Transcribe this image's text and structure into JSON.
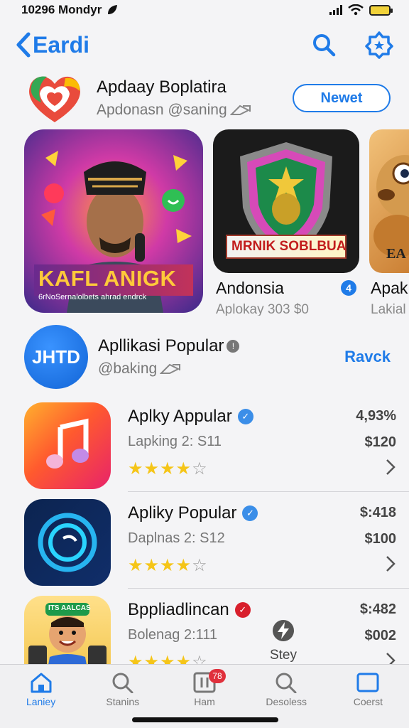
{
  "status": {
    "time": "10296 Mondyr"
  },
  "nav": {
    "back_title": "Eardi"
  },
  "featured": {
    "title": "Apdaay Boplatira",
    "subtitle": "Apdonasn @saning",
    "button_label": "Newet"
  },
  "carousel": {
    "big": {
      "title": "KAFL ANIGK",
      "subtitle": "6rNoSernalolbets ahrad endrck"
    },
    "mid": {
      "art_title": "MRNIK SOBLBUA",
      "caption": "Andonsia",
      "badge": "4",
      "sub": "Aplokay 303  $0"
    },
    "small": {
      "art_title": "EA",
      "caption": "Apak",
      "sub": "Lakial"
    }
  },
  "section": {
    "logo_text": "JHTD",
    "title": "Apllikasi Popular",
    "subtitle": "@baking",
    "link_label": "Ravck"
  },
  "apps": [
    {
      "title": "Aplky Appular",
      "sub": "Lapking 2: S11",
      "rating": "4,93%",
      "price": "$120",
      "stars": 4
    },
    {
      "title": "Apliky Popular",
      "sub": "Daplnas 2: S12",
      "rating": "$:418",
      "price": "$100",
      "stars": 4
    },
    {
      "title": "Bppliadlincan",
      "sub": "Bolenag 2:111",
      "rating": "$:482",
      "price": "$002",
      "stars": 4
    }
  ],
  "third_icon_banner": "ITS AALCAS",
  "stay": {
    "label": "Stey"
  },
  "tabs": [
    {
      "label": "Laniey",
      "icon": "home-icon",
      "active": true
    },
    {
      "label": "Stanins",
      "icon": "search-icon"
    },
    {
      "label": "Ham",
      "icon": "grid-icon",
      "badge": "78"
    },
    {
      "label": "Desoless",
      "icon": "search-icon"
    },
    {
      "label": "Coerst",
      "icon": "square-icon"
    }
  ],
  "colors": {
    "accent": "#1f7be8",
    "star": "#f5c518",
    "badge_red": "#e0303c"
  }
}
